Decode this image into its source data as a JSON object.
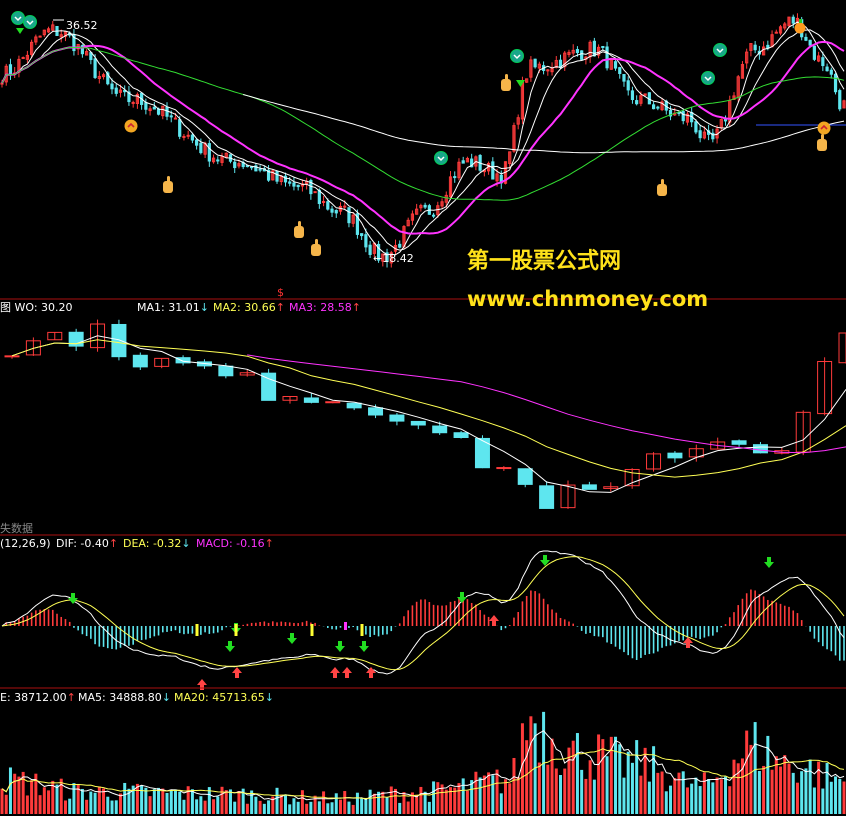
{
  "watermark": {
    "line1": "第一股票公式网",
    "line2": "www.chnmoney.com",
    "color": "#ffe21a"
  },
  "colors": {
    "up": "#ff3b3b",
    "down": "#5ee6ef",
    "white": "#ffffff",
    "yellow": "#ffff55",
    "magenta": "#ff33ff",
    "green": "#33dd33",
    "blue": "#3355ff",
    "divider": "#aa1111",
    "arrow_down": "#22dd22",
    "arrow_up": "#ff4444"
  },
  "panels": {
    "main": {
      "max_label": "36.52",
      "min_label": "18.42",
      "dollar_mark": "$",
      "chart_data": {
        "type": "candlestick",
        "ylim": [
          17,
          38
        ],
        "n_bars": 200,
        "key_prices": [
          33,
          36.52,
          31,
          26,
          24,
          22,
          18.42,
          22,
          26,
          25,
          33.5,
          35,
          31,
          29.5,
          27.5,
          35,
          37.3,
          34,
          30.5
        ],
        "key_index": [
          0,
          12,
          30,
          55,
          70,
          80,
          90,
          100,
          110,
          118,
          125,
          140,
          150,
          162,
          167,
          178,
          187,
          194,
          199
        ],
        "ma_lines": [
          {
            "color": "white",
            "period": 5
          },
          {
            "color": "white",
            "period": 10
          },
          {
            "color": "magenta",
            "period": 20
          },
          {
            "color": "green",
            "period": 60
          },
          {
            "color": "white",
            "period": 120,
            "start": 57
          }
        ]
      }
    },
    "wo": {
      "title": "图 WO: 30.20",
      "ma1": "MA1: 31.01",
      "ma1_arrow": "↓",
      "ma2": "MA2: 30.66",
      "ma2_arrow": "↑",
      "ma3": "MA3: 28.58",
      "ma3_arrow": "↑",
      "chart_data": {
        "type": "candlestick",
        "ylim": [
          17,
          38
        ],
        "n_bars": 40,
        "ma_lines": [
          {
            "name": "MA1",
            "color": "white"
          },
          {
            "name": "MA2",
            "color": "yellow"
          },
          {
            "name": "MA3",
            "color": "magenta"
          }
        ]
      }
    },
    "macd": {
      "corner_text": "失数据",
      "params": "(12,26,9)",
      "dif": "DIF: -0.40",
      "dif_arrow": "↑",
      "dea": "DEA: -0.32",
      "dea_arrow": "↓",
      "macd": "MACD: -0.16",
      "macd_arrow": "↑",
      "chart_data": {
        "type": "bar",
        "ylim": [
          -1.4,
          1.4
        ],
        "series": [
          "DIF",
          "DEA",
          "MACD"
        ]
      }
    },
    "vol": {
      "vol": "E: 38712.00",
      "vol_arrow": "↑",
      "ma5": "MA5: 34888.80",
      "ma5_arrow": "↓",
      "ma20": "MA20: 45713.65",
      "ma20_arrow": "↓",
      "chart_data": {
        "type": "bar",
        "ylim": [
          0,
          100000
        ],
        "series": [
          {
            "name": "MA5",
            "color": "white"
          },
          {
            "name": "MA20",
            "color": "yellow"
          }
        ]
      }
    }
  }
}
